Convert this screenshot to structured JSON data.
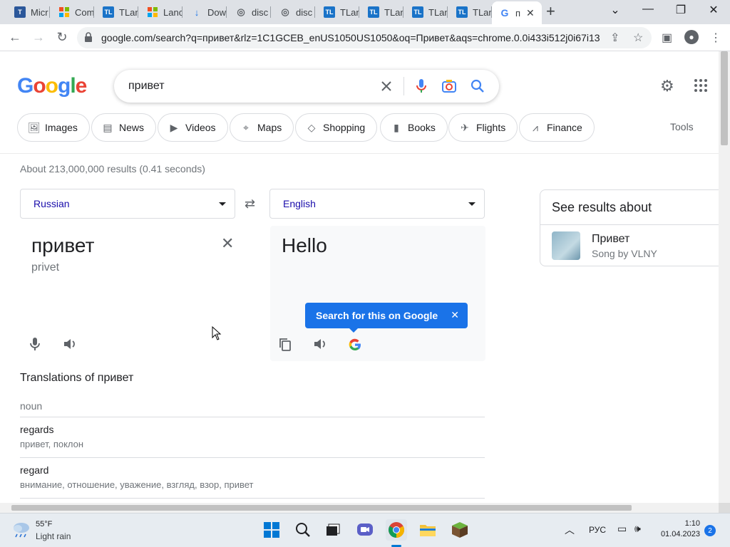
{
  "browser": {
    "tabs": [
      {
        "title": "Micr",
        "icon": "T",
        "color": "#2b579a"
      },
      {
        "title": "Com",
        "icon": "ms",
        "color": "#f25022"
      },
      {
        "title": "TLan",
        "icon": "TL",
        "color": "#1a73c8"
      },
      {
        "title": "Lanc",
        "icon": "ms",
        "color": "#f25022"
      },
      {
        "title": "Dow",
        "icon": "↓",
        "color": "#1a73e8"
      },
      {
        "title": "disc",
        "icon": "◎",
        "color": "#5f6368"
      },
      {
        "title": "disc",
        "icon": "◎",
        "color": "#5f6368"
      },
      {
        "title": "TLan",
        "icon": "TL",
        "color": "#1a73c8"
      },
      {
        "title": "TLan",
        "icon": "TL",
        "color": "#1a73c8"
      },
      {
        "title": "TLan",
        "icon": "TL",
        "color": "#1a73c8"
      },
      {
        "title": "TLan",
        "icon": "TL",
        "color": "#1a73c8"
      },
      {
        "title": "п",
        "icon": "G",
        "color": "#4285f4",
        "active": true
      }
    ],
    "url": "google.com/search?q=привет&rlz=1C1GCEB_enUS1050US1050&oq=Привет&aqs=chrome.0.0i433i512j0i67i13..."
  },
  "google": {
    "logo_letters": [
      "G",
      "o",
      "o",
      "g",
      "l",
      "e"
    ],
    "logo_colors": [
      "#4285f4",
      "#ea4335",
      "#fbbc05",
      "#4285f4",
      "#34a853",
      "#ea4335"
    ],
    "query": "привет",
    "chips": [
      {
        "label": "Images",
        "icon": "image-icon"
      },
      {
        "label": "News",
        "icon": "news-icon"
      },
      {
        "label": "Videos",
        "icon": "video-icon"
      },
      {
        "label": "Maps",
        "icon": "map-pin-icon"
      },
      {
        "label": "Shopping",
        "icon": "tag-icon"
      },
      {
        "label": "Books",
        "icon": "book-icon"
      },
      {
        "label": "Flights",
        "icon": "plane-icon"
      },
      {
        "label": "Finance",
        "icon": "finance-icon"
      }
    ],
    "tools_label": "Tools",
    "stats": "About 213,000,000 results (0.41 seconds)"
  },
  "translate": {
    "source_lang": "Russian",
    "target_lang": "English",
    "source_text": "привет",
    "source_translit": "privet",
    "target_text": "Hello",
    "tooltip": "Search for this on Google",
    "translations_header": "Translations of привет",
    "pos": "noun",
    "entries": [
      {
        "word": "regards",
        "synonyms": "привет, поклон"
      },
      {
        "word": "regard",
        "synonyms": "внимание, отношение, уважение, взгляд, взор, привет"
      }
    ]
  },
  "knowledge": {
    "title": "See results about",
    "name": "Привет",
    "subtitle": "Song by VLNY"
  },
  "taskbar": {
    "temperature": "55°F",
    "weather": "Light rain",
    "lang": "РУС",
    "time": "1:10",
    "date": "01.04.2023",
    "notifications": "2"
  }
}
